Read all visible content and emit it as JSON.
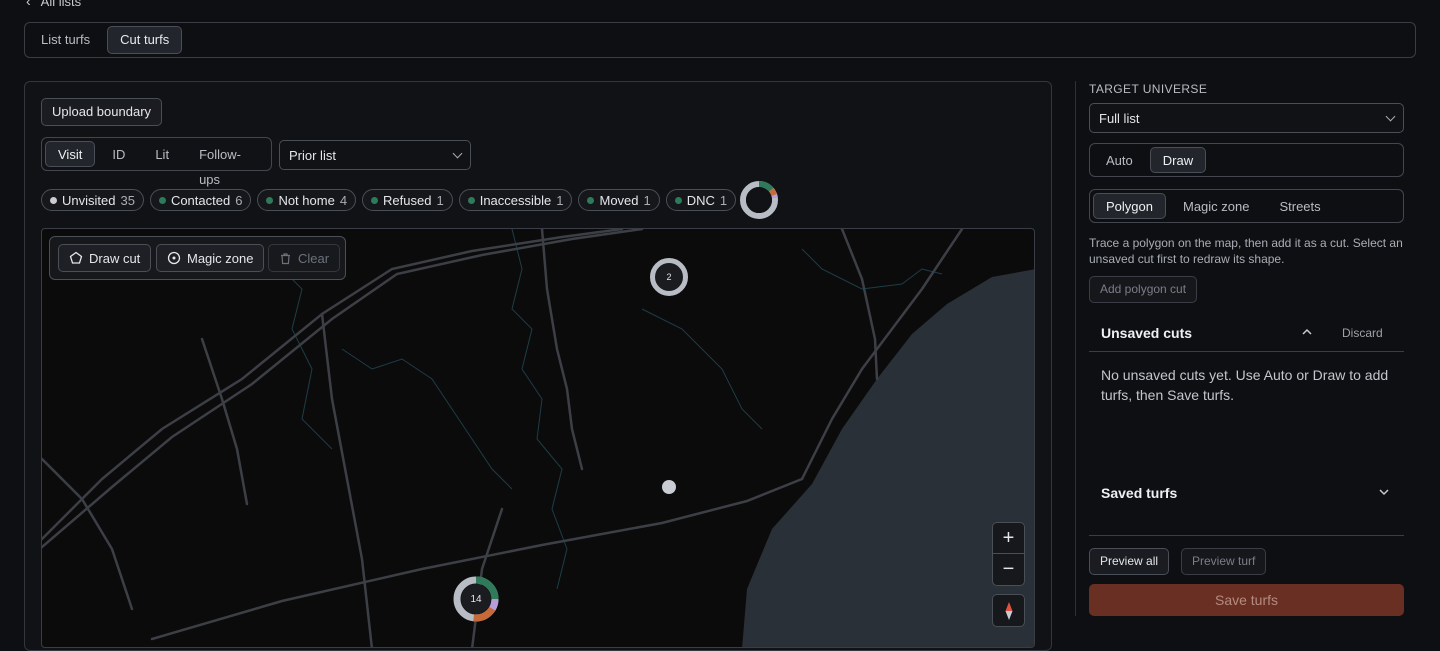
{
  "nav": {
    "back_label": "All lists"
  },
  "tabs": [
    {
      "label": "List turfs",
      "active": false
    },
    {
      "label": "Cut turfs",
      "active": true
    }
  ],
  "main": {
    "upload_label": "Upload boundary",
    "mode_tabs": [
      {
        "label": "Visit",
        "active": true
      },
      {
        "label": "ID",
        "active": false
      },
      {
        "label": "Lit",
        "active": false
      },
      {
        "label": "Follow-ups",
        "active": false
      }
    ],
    "prior_select": {
      "value": "Prior list"
    },
    "status_chips": [
      {
        "label": "Unvisited",
        "count": "35",
        "color": "#c9ccd3"
      },
      {
        "label": "Contacted",
        "count": "6",
        "color": "#2f7a5b"
      },
      {
        "label": "Not home",
        "count": "4",
        "color": "#2f7a5b"
      },
      {
        "label": "Refused",
        "count": "1",
        "color": "#2f7a5b"
      },
      {
        "label": "Inaccessible",
        "count": "1",
        "color": "#2f7a5b"
      },
      {
        "label": "Moved",
        "count": "1",
        "color": "#2f7a5b"
      },
      {
        "label": "DNC",
        "count": "1",
        "color": "#2f7a5b"
      }
    ],
    "map_toolbar": {
      "draw_cut": "Draw cut",
      "magic_zone": "Magic zone",
      "clear": "Clear"
    },
    "map": {
      "cluster_top": "2",
      "cluster_bottom": "14",
      "zoom_in": "+",
      "zoom_out": "−",
      "water_color": "#2a3038",
      "land_color": "#0b0b0c"
    }
  },
  "sidebar": {
    "section_label": "TARGET UNIVERSE",
    "universe_select": {
      "value": "Full list"
    },
    "method_tabs": [
      {
        "label": "Auto",
        "active": false
      },
      {
        "label": "Draw",
        "active": true
      }
    ],
    "draw_tabs": [
      {
        "label": "Polygon",
        "active": true
      },
      {
        "label": "Magic zone",
        "active": false
      },
      {
        "label": "Streets",
        "active": false
      }
    ],
    "help_text": "Trace a polygon on the map, then add it as a cut. Select an unsaved cut first to redraw its shape.",
    "add_polygon_label": "Add polygon cut",
    "unsaved": {
      "title": "Unsaved cuts",
      "discard": "Discard",
      "empty_text": "No unsaved cuts yet. Use Auto or Draw to add turfs, then Save turfs."
    },
    "saved": {
      "title": "Saved turfs"
    },
    "preview_all": "Preview all",
    "preview_turf": "Preview turf",
    "save_label": "Save turfs",
    "accent_color": "#6a2f23"
  }
}
